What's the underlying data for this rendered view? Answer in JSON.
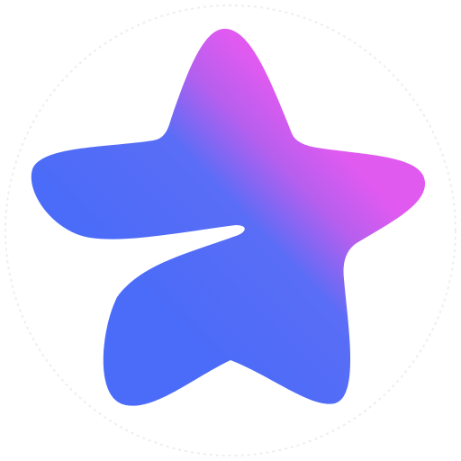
{
  "icon": {
    "name": "gradient-star-logo",
    "background_color": "#ffffff",
    "ring_color": "#eeeeee",
    "gradient_colors": [
      "#4b6cf8",
      "#5a6df6",
      "#b65fee",
      "#e05af0"
    ]
  }
}
